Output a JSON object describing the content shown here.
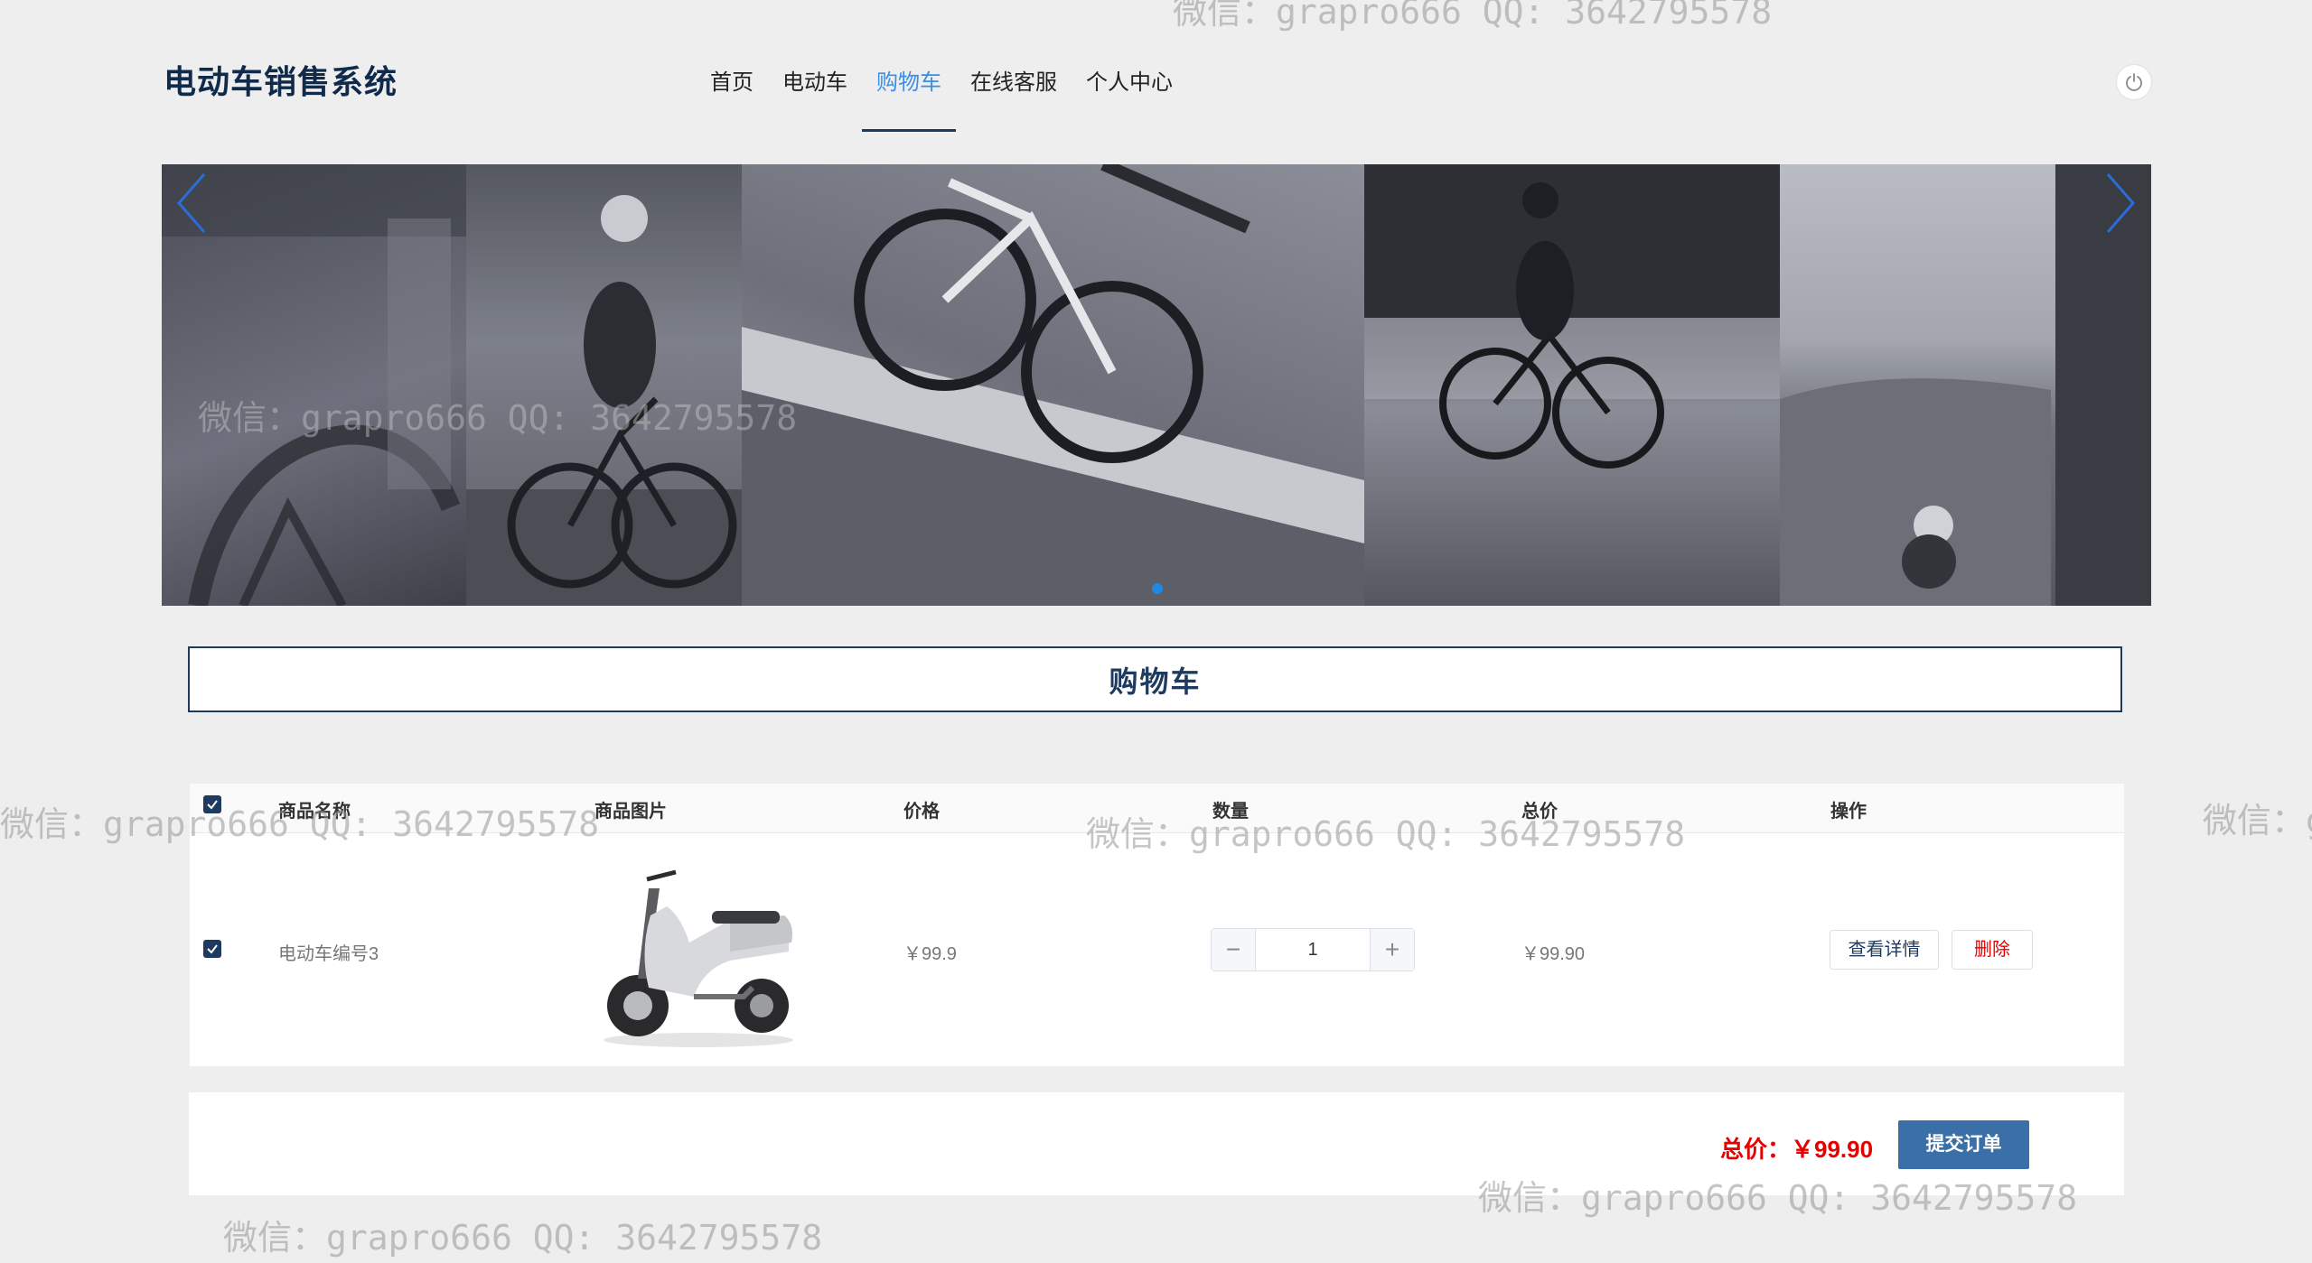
{
  "header": {
    "title": "电动车销售系统",
    "nav": [
      "首页",
      "电动车",
      "购物车",
      "在线客服",
      "个人中心"
    ],
    "active_nav": "购物车"
  },
  "banner": {
    "active_slide": 1
  },
  "cart": {
    "title": "购物车",
    "columns": [
      "商品名称",
      "商品图片",
      "价格",
      "数量",
      "总价",
      "操作"
    ],
    "rows": [
      {
        "name": "电动车编号3",
        "price": "￥99.9",
        "quantity": "1",
        "total": "￥99.90",
        "detail_label": "查看详情",
        "delete_label": "删除",
        "checked": true
      }
    ],
    "stepper": {
      "minus": "−",
      "plus": "+"
    },
    "total_label": "总价：￥99.90",
    "submit_label": "提交订单"
  },
  "watermark": "微信：grapro666 QQ: 3642795578",
  "colors": {
    "primary": "#1e3a5f",
    "accent": "#3a8ee6",
    "danger": "#e60000",
    "submit": "#3a6fa8"
  }
}
